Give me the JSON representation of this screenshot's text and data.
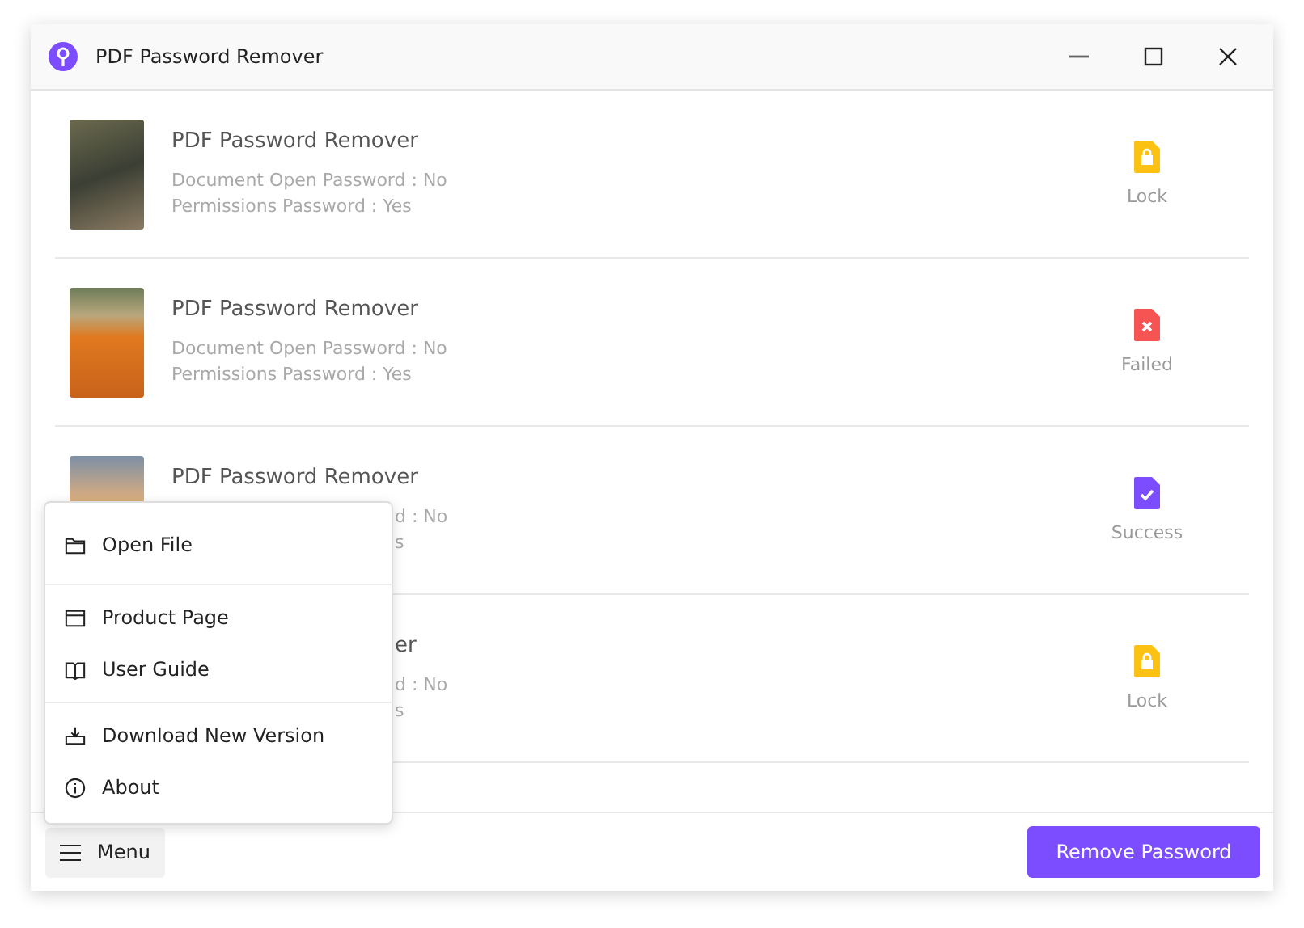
{
  "window": {
    "title": "PDF Password Remover"
  },
  "files": [
    {
      "title": "PDF Password Remover",
      "lines": [
        "Document Open Password : No",
        "Permissions Password : Yes"
      ],
      "partial": false,
      "status": {
        "kind": "lock",
        "label": "Lock"
      }
    },
    {
      "title": "PDF Password Remover",
      "lines": [
        "Document Open Password : No",
        "Permissions Password : Yes"
      ],
      "partial": false,
      "status": {
        "kind": "failed",
        "label": "Failed"
      }
    },
    {
      "title": "PDF Password Remover",
      "lines": [
        "d : No",
        "s"
      ],
      "partial": true,
      "status": {
        "kind": "success",
        "label": "Success"
      }
    },
    {
      "title": "er",
      "lines": [
        "d : No",
        "s"
      ],
      "partial": true,
      "status": {
        "kind": "lock",
        "label": "Lock"
      }
    }
  ],
  "menu": {
    "items": [
      {
        "kind": "folder",
        "label": "Open File"
      },
      {
        "kind": "browser",
        "label": "Product Page"
      },
      {
        "kind": "book",
        "label": "User Guide"
      },
      {
        "kind": "download",
        "label": "Download New Version"
      },
      {
        "kind": "info",
        "label": "About"
      }
    ]
  },
  "footer": {
    "menu_button": "Menu",
    "action_button": "Remove Password"
  }
}
